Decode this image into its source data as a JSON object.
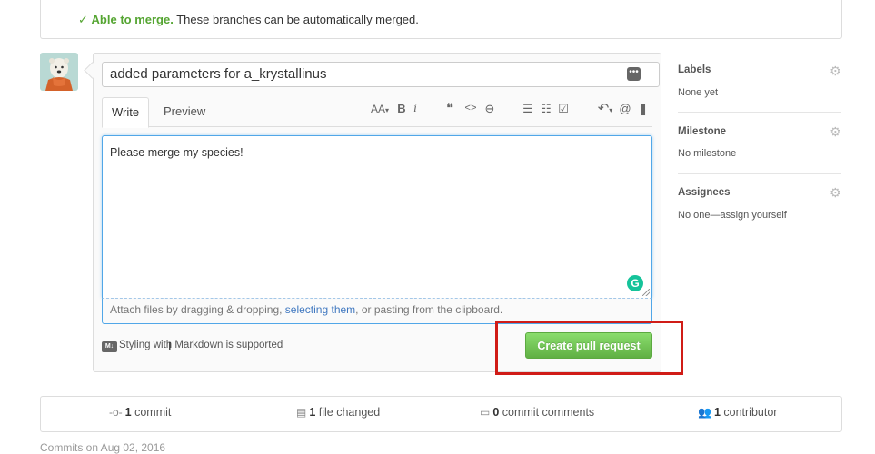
{
  "merge": {
    "status_strong": "Able to merge.",
    "status_text": "These branches can be automatically merged."
  },
  "composer": {
    "title_value": "added parameters for a_krystallinus",
    "tabs": {
      "write": "Write",
      "preview": "Preview"
    },
    "toolbar": {
      "header": "AA",
      "bold": "B",
      "italic": "i",
      "quote": "❝",
      "code": "<>",
      "link": "⊖",
      "ul": "☰",
      "ol": "☷",
      "tasks": "☑",
      "reply": "↶",
      "mention": "@",
      "bookmark": "❚"
    },
    "body_value": "Please merge my species!",
    "attach": {
      "before": "Attach files by dragging & dropping, ",
      "link": "selecting them",
      "after": ", or pasting from the clipboard."
    },
    "markdown_note": "Styling with Markdown is supported",
    "markdown_icon_text": "M↓",
    "submit_label": "Create pull request",
    "grammarly_letter": "G"
  },
  "sidebar": {
    "labels": {
      "heading": "Labels",
      "value": "None yet"
    },
    "milestone": {
      "heading": "Milestone",
      "value": "No milestone"
    },
    "assignees": {
      "heading": "Assignees",
      "value": "No one—assign yourself"
    }
  },
  "summary": {
    "commits": {
      "count": "1",
      "label": "commit"
    },
    "files": {
      "count": "1",
      "label": "file changed"
    },
    "comments": {
      "count": "0",
      "label": "commit comments"
    },
    "contributors": {
      "count": "1",
      "label": "contributor"
    }
  },
  "bottom_partial": "Commits on Aug 02, 2016",
  "colors": {
    "success_green": "#55a532",
    "button_green": "#60b044",
    "link_blue": "#4078c0",
    "focus_blue": "#51a7e8",
    "highlight_red": "#d01c17"
  }
}
